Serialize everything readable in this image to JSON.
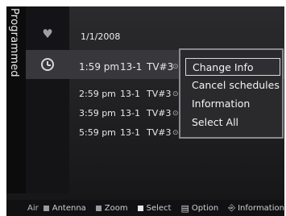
{
  "sidebar": {
    "tab_label": "Programmed"
  },
  "list": {
    "date": "1/1/2008",
    "rows": [
      {
        "time": "1:59 pm",
        "channel": "13-1",
        "program": "TV#3"
      },
      {
        "time": "2:59 pm",
        "channel": "13-1",
        "program": "TV#3"
      },
      {
        "time": "3:59 pm",
        "channel": "13-1",
        "program": "TV#3"
      },
      {
        "time": "5:59 pm",
        "channel": "13-1",
        "program": "TV#3"
      }
    ]
  },
  "popup_menu": {
    "items": [
      {
        "label": "Change Info",
        "selected": true
      },
      {
        "label": "Cancel schedules"
      },
      {
        "label": "Information"
      },
      {
        "label": "Select All"
      }
    ]
  },
  "footer": {
    "source": "Air",
    "buttons": [
      {
        "label": "Antenna",
        "color": "#9a9aa0"
      },
      {
        "label": "Zoom",
        "color": "#9a9aa0"
      },
      {
        "label": "Select",
        "color": "#e6e6e6"
      },
      {
        "label": "Option",
        "icon": "option-icon"
      },
      {
        "label": "Information",
        "icon": "info-icon"
      }
    ]
  },
  "icons": {
    "favorite": "heart-icon",
    "timer": "clock-icon",
    "record": "record-icon"
  }
}
